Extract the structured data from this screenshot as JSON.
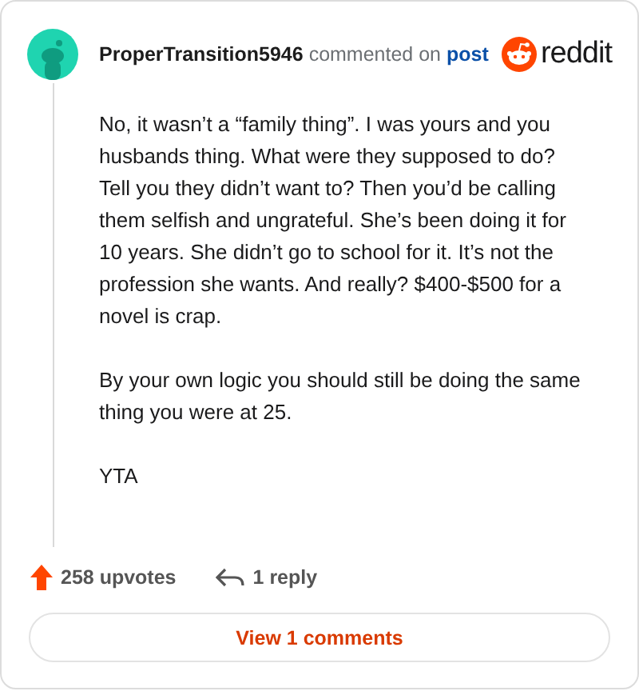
{
  "comment": {
    "author": "ProperTransition5946",
    "action": "commented on",
    "link": "post",
    "brand": "reddit",
    "paragraphs": [
      "No, it wasn’t a “family thing”. I was yours and you husbands thing. What were they supposed to do? Tell you they didn’t want to? Then you’d be calling them selfish and ungrateful. She’s been doing it for 10 years. She didn’t go to school for it. It’s not the profession she wants. And really? $400-$500 for a novel is crap.",
      "By your own logic you should still be doing the same thing you were at 25.",
      "YTA"
    ],
    "upvotes": "258 upvotes",
    "replies": "1 reply"
  },
  "button": "View 1 comments"
}
